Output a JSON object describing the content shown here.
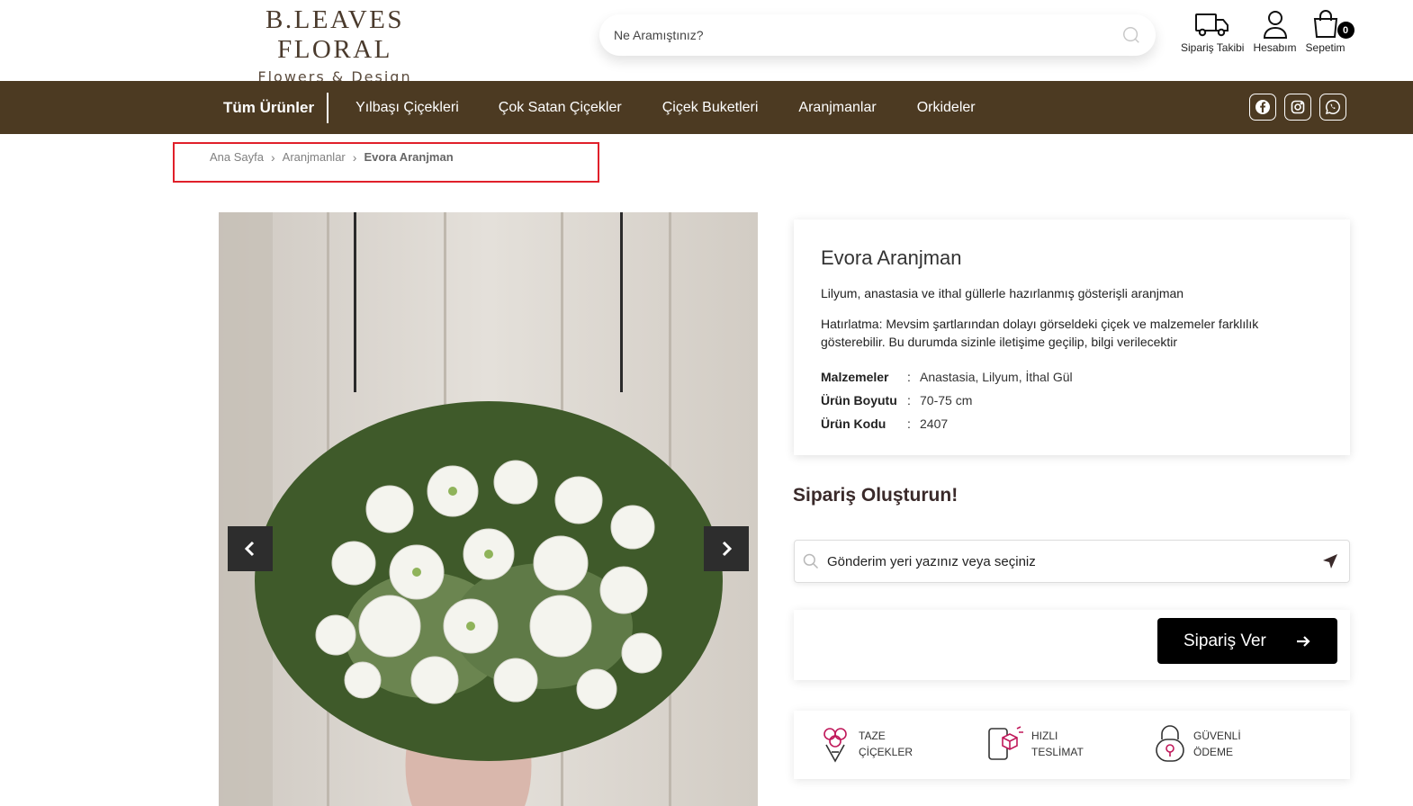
{
  "header": {
    "logo_main": "B.LEAVES FLORAL",
    "logo_sub": "Flowers & Design",
    "search_placeholder": "Ne Aramıştınız?",
    "actions": {
      "order_tracking": "Sipariş Takibi",
      "account": "Hesabım",
      "cart": "Sepetim",
      "cart_count": "0"
    }
  },
  "nav": {
    "all_products": "Tüm Ürünler",
    "links": [
      "Yılbaşı Çiçekleri",
      "Çok Satan Çiçekler",
      "Çiçek Buketleri",
      "Aranjmanlar",
      "Orkideler"
    ],
    "social_icons": [
      "facebook-icon",
      "instagram-icon",
      "whatsapp-icon"
    ]
  },
  "breadcrumb": {
    "home": "Ana Sayfa",
    "category": "Aranjmanlar",
    "current": "Evora Aranjman"
  },
  "product": {
    "title": "Evora Aranjman",
    "description": "Lilyum, anastasia ve ithal güllerle hazırlanmış gösterişli aranjman",
    "note": "Hatırlatma: Mevsim şartlarından dolayı görseldeki çiçek ve malzemeler farklılık gösterebilir. Bu durumda sizinle iletişime geçilip, bilgi verilecektir",
    "specs": [
      {
        "key": "Malzemeler",
        "value": "Anastasia, Lilyum, İthal Gül"
      },
      {
        "key": "Ürün Boyutu",
        "value": "70-75 cm"
      },
      {
        "key": "Ürün Kodu",
        "value": "2407"
      }
    ]
  },
  "order": {
    "heading": "Sipariş Oluşturun!",
    "location_placeholder": "Gönderim yeri yazınız veya seçiniz",
    "button_label": "Sipariş Ver"
  },
  "features": [
    {
      "line1": "TAZE",
      "line2": "ÇİÇEKLER",
      "icon": "flower-bouquet-icon"
    },
    {
      "line1": "HIZLI",
      "line2": "TESLİMAT",
      "icon": "fast-delivery-icon"
    },
    {
      "line1": "GÜVENLİ",
      "line2": "ÖDEME",
      "icon": "secure-payment-icon"
    }
  ],
  "colors": {
    "nav_bg": "#4c3a22",
    "logo": "#4a3a2c",
    "accent_pink": "#c0185a",
    "breadcrumb_highlight": "#e0202a",
    "button": "#000000"
  }
}
